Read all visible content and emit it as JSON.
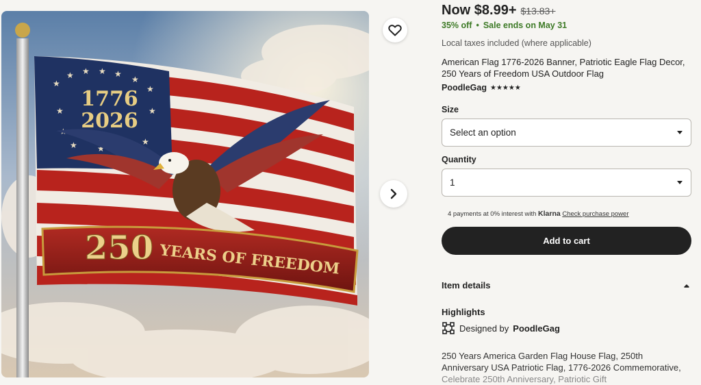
{
  "product": {
    "price_now": "Now $8.99+",
    "price_original": "$13.83+",
    "discount": "35% off",
    "sale_dot": "•",
    "sale_ends": "Sale ends on May 31",
    "taxes_note": "Local taxes included (where applicable)",
    "title": "American Flag 1776-2026 Banner, Patriotic Eagle Flag Decor, 250 Years of Freedom USA Outdoor Flag",
    "shop_name": "PoodleGag",
    "rating_stars": "★★★★★",
    "rating_value": 4.5
  },
  "options": {
    "size_label": "Size",
    "size_value": "Select an option",
    "quantity_label": "Quantity",
    "quantity_value": "1"
  },
  "klarna": {
    "text": "4 payments at 0% interest with",
    "brand": "Klarna",
    "link": "Check purchase power"
  },
  "cart": {
    "button_label": "Add to cart"
  },
  "details": {
    "heading": "Item details",
    "highlights_heading": "Highlights",
    "designed_prefix": "Designed by",
    "designed_by": "PoodleGag",
    "description_lines": [
      "250 Years America Garden Flag House Flag, 250th",
      "Anniversary USA Patriotic Flag, 1776-2026 Commemorative,",
      "Celebrate 250th Anniversary, Patriotic Gift"
    ]
  },
  "image": {
    "flag_top_text": "1776",
    "flag_second_text": "2026",
    "banner_number": "250",
    "banner_text": "YEARS OF FREEDOM"
  },
  "icons": {
    "favorite": "heart-icon",
    "next": "chevron-right-icon",
    "dropdown": "caret-down-icon",
    "collapse": "chevron-up-icon",
    "designed": "design-frame-icon"
  },
  "colors": {
    "accent_dark": "#222222",
    "sale_green": "#3d7a26",
    "background": "#f6f5f2"
  }
}
